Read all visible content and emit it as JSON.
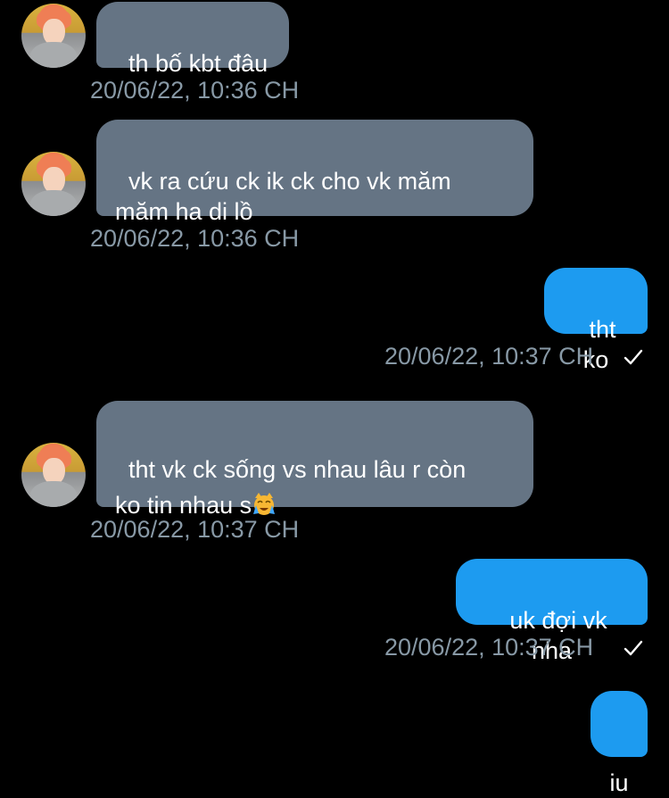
{
  "conversation": {
    "messages": [
      {
        "direction": "received",
        "text": "th bố kbt đâu",
        "timestamp": "20/06/22, 10:36 CH"
      },
      {
        "direction": "received",
        "text": "vk ra cứu ck ik ck cho vk măm\nmăm ha di lồ",
        "timestamp": "20/06/22, 10:36 CH"
      },
      {
        "direction": "sent",
        "text": "tht ko",
        "timestamp": "20/06/22, 10:37 CH",
        "status_icon": "check-icon"
      },
      {
        "direction": "received",
        "text_prefix": "tht vk ck sống vs nhau lâu r còn\nko tin nhau s",
        "emoji": "crying-cat-emoji",
        "timestamp": "20/06/22, 10:37 CH"
      },
      {
        "direction": "sent",
        "text": "uk đợi vk nha",
        "timestamp": "20/06/22, 10:37 CH",
        "status_icon": "check-icon"
      },
      {
        "direction": "sent",
        "text": "iu"
      }
    ]
  },
  "colors": {
    "background": "#000000",
    "received_bubble": "#657484",
    "sent_bubble": "#1d9bf0",
    "timestamp": "#8899a6",
    "message_text": "#ffffff"
  }
}
